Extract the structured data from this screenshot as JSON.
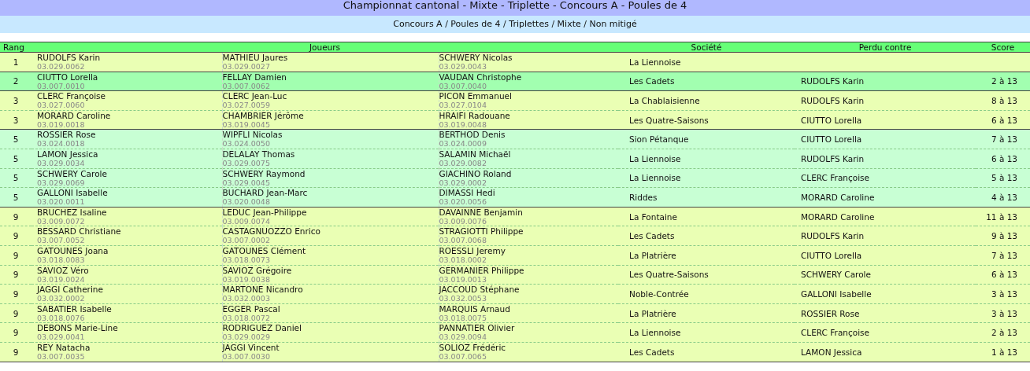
{
  "title": "Championnat cantonal - Mixte - Triplette - Concours A - Poules de 4",
  "subtitle": "Concours A / Poules de 4 / Triplettes / Mixte / Non mitigé",
  "columns": {
    "rank": "Rang",
    "players": "Joueurs",
    "club": "Société",
    "lost_to": "Perdu contre",
    "score": "Score"
  },
  "rows": [
    {
      "rank": "1",
      "color": "#eaffb4",
      "players": [
        {
          "name": "RUDOLFS Karin",
          "licence": "03.029.0062"
        },
        {
          "name": "MATHIEU Jaures",
          "licence": "03.029.0027"
        },
        {
          "name": "SCHWERY Nicolas",
          "licence": "03.029.0043"
        }
      ],
      "club": "La Liennoise"
    },
    {
      "rank": "2",
      "color": "#a2ffb0",
      "players": [
        {
          "name": "CIUTTO Lorella",
          "licence": "03.007.0010"
        },
        {
          "name": "FELLAY Damien",
          "licence": "03.007.0062"
        },
        {
          "name": "VAUDAN Christophe",
          "licence": "03.007.0040"
        }
      ],
      "club": "Les Cadets",
      "lost_to": "RUDOLFS Karin",
      "score": "2 à 13"
    },
    {
      "rank": "3",
      "color": "#eaffb4",
      "players": [
        {
          "name": "CLERC Françoise",
          "licence": "03.027.0060"
        },
        {
          "name": "CLERC Jean-Luc",
          "licence": "03.027.0059"
        },
        {
          "name": "PICON Emmanuel",
          "licence": "03.027.0104"
        }
      ],
      "club": "La Chablaisienne",
      "lost_to": "RUDOLFS Karin",
      "score": "8 à 13"
    },
    {
      "rank": "3",
      "color": "#eaffb4",
      "players": [
        {
          "name": "MORARD Caroline",
          "licence": "03.019.0018"
        },
        {
          "name": "CHAMBRIER Jérôme",
          "licence": "03.019.0045"
        },
        {
          "name": "HRAIFI Radouane",
          "licence": "03.019.0048"
        }
      ],
      "club": "Les Quatre-Saisons",
      "lost_to": "CIUTTO Lorella",
      "score": "6 à 13"
    },
    {
      "rank": "5",
      "color": "#c8ffd4",
      "players": [
        {
          "name": "ROSSIER Rose",
          "licence": "03.024.0018"
        },
        {
          "name": "WIPFLI Nicolas",
          "licence": "03.024.0050"
        },
        {
          "name": "BERTHOD Denis",
          "licence": "03.024.0009"
        }
      ],
      "club": "Sion Pétanque",
      "lost_to": "CIUTTO Lorella",
      "score": "7 à 13"
    },
    {
      "rank": "5",
      "color": "#c8ffd4",
      "players": [
        {
          "name": "LAMON Jessica",
          "licence": "03.029.0034"
        },
        {
          "name": "DELALAY Thomas",
          "licence": "03.029.0075"
        },
        {
          "name": "SALAMIN Michaël",
          "licence": "03.029.0082"
        }
      ],
      "club": "La Liennoise",
      "lost_to": "RUDOLFS Karin",
      "score": "6 à 13"
    },
    {
      "rank": "5",
      "color": "#c8ffd4",
      "players": [
        {
          "name": "SCHWERY Carole",
          "licence": "03.029.0069"
        },
        {
          "name": "SCHWERY Raymond",
          "licence": "03.029.0045"
        },
        {
          "name": "GIACHINO Roland",
          "licence": "03.029.0002"
        }
      ],
      "club": "La Liennoise",
      "lost_to": "CLERC Françoise",
      "score": "5 à 13"
    },
    {
      "rank": "5",
      "color": "#c8ffd4",
      "players": [
        {
          "name": "GALLONI Isabelle",
          "licence": "03.020.0011"
        },
        {
          "name": "BUCHARD Jean-Marc",
          "licence": "03.020.0048"
        },
        {
          "name": "DIMASSI Hedi",
          "licence": "03.020.0056"
        }
      ],
      "club": "Riddes",
      "lost_to": "MORARD Caroline",
      "score": "4 à 13"
    },
    {
      "rank": "9",
      "color": "#eaffb4",
      "players": [
        {
          "name": "BRUCHEZ Isaline",
          "licence": "03.009.0072"
        },
        {
          "name": "LEDUC Jean-Philippe",
          "licence": "03.009.0074"
        },
        {
          "name": "DAVAINNE Benjamin",
          "licence": "03.009.0076"
        }
      ],
      "club": "La Fontaine",
      "lost_to": "MORARD Caroline",
      "score": "11 à 13"
    },
    {
      "rank": "9",
      "color": "#eaffb4",
      "players": [
        {
          "name": "BESSARD Christiane",
          "licence": "03.007.0052"
        },
        {
          "name": "CASTAGNUOZZO Enrico",
          "licence": "03.007.0002"
        },
        {
          "name": "STRAGIOTTI Philippe",
          "licence": "03.007.0068"
        }
      ],
      "club": "Les Cadets",
      "lost_to": "RUDOLFS Karin",
      "score": "9 à 13"
    },
    {
      "rank": "9",
      "color": "#eaffb4",
      "players": [
        {
          "name": "GATOUNES Joana",
          "licence": "03.018.0083"
        },
        {
          "name": "GATOUNES Clément",
          "licence": "03.018.0073"
        },
        {
          "name": "ROESSLI Jeremy",
          "licence": "03.018.0002"
        }
      ],
      "club": "La Platrière",
      "lost_to": "CIUTTO Lorella",
      "score": "7 à 13"
    },
    {
      "rank": "9",
      "color": "#eaffb4",
      "players": [
        {
          "name": "SAVIOZ Véro",
          "licence": "03.019.0024"
        },
        {
          "name": "SAVIOZ Grégoire",
          "licence": "03.019.0038"
        },
        {
          "name": "GERMANIER Philippe",
          "licence": "03.019.0013"
        }
      ],
      "club": "Les Quatre-Saisons",
      "lost_to": "SCHWERY Carole",
      "score": "6 à 13"
    },
    {
      "rank": "9",
      "color": "#eaffb4",
      "players": [
        {
          "name": "JAGGI Catherine",
          "licence": "03.032.0002"
        },
        {
          "name": "MARTONE Nicandro",
          "licence": "03.032.0003"
        },
        {
          "name": "JACCOUD Stéphane",
          "licence": "03.032.0053"
        }
      ],
      "club": "Noble-Contrée",
      "lost_to": "GALLONI Isabelle",
      "score": "3 à 13"
    },
    {
      "rank": "9",
      "color": "#eaffb4",
      "players": [
        {
          "name": "SABATIER Isabelle",
          "licence": "03.018.0076"
        },
        {
          "name": "EGGER Pascal",
          "licence": "03.018.0072"
        },
        {
          "name": "MARQUIS Arnaud",
          "licence": "03.018.0075"
        }
      ],
      "club": "La Platrière",
      "lost_to": "ROSSIER Rose",
      "score": "3 à 13"
    },
    {
      "rank": "9",
      "color": "#eaffb4",
      "players": [
        {
          "name": "DEBONS Marie-Line",
          "licence": "03.029.0041"
        },
        {
          "name": "RODRIGUEZ Daniel",
          "licence": "03.029.0029"
        },
        {
          "name": "PANNATIER Olivier",
          "licence": "03.029.0094"
        }
      ],
      "club": "La Liennoise",
      "lost_to": "CLERC Françoise",
      "score": "2 à 13"
    },
    {
      "rank": "9",
      "color": "#eaffb4",
      "players": [
        {
          "name": "REY Natacha",
          "licence": "03.007.0035"
        },
        {
          "name": "JAGGI Vincent",
          "licence": "03.007.0030"
        },
        {
          "name": "SOLIOZ Frédéric",
          "licence": "03.007.0065"
        }
      ],
      "club": "Les Cadets",
      "lost_to": "LAMON Jessica",
      "score": "1 à 13"
    }
  ]
}
